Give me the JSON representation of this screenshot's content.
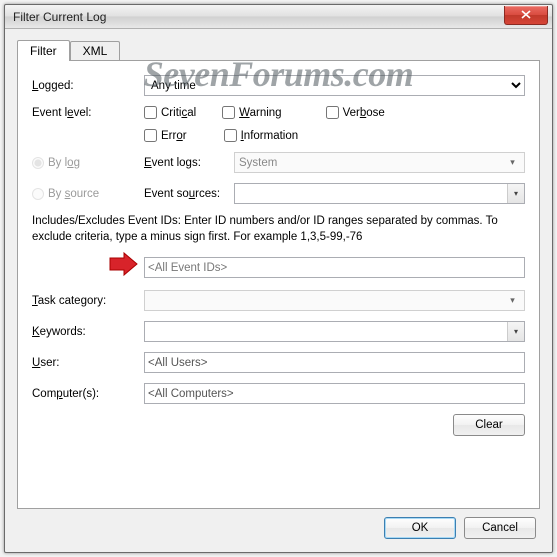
{
  "window": {
    "title": "Filter Current Log"
  },
  "watermark": "SevenForums.com",
  "tabs": {
    "filter": "Filter",
    "xml": "XML"
  },
  "form": {
    "logged_label": "Logged:",
    "logged_value": "Any time",
    "eventlevel_label": "Event level:",
    "critical": "Critical",
    "warning": "Warning",
    "verbose": "Verbose",
    "error": "Error",
    "information": "Information",
    "bylog": "By log",
    "bysource": "By source",
    "eventlogs_label": "Event logs:",
    "eventlogs_value": "System",
    "eventsources_label": "Event sources:",
    "description": "Includes/Excludes Event IDs: Enter ID numbers and/or ID ranges separated by commas. To exclude criteria, type a minus sign first. For example 1,3,5-99,-76",
    "eventids_placeholder": "<All Event IDs>",
    "taskcat_label": "Task category:",
    "keywords_label": "Keywords:",
    "user_label": "User:",
    "user_value": "<All Users>",
    "computers_label": "Computer(s):",
    "computers_value": "<All Computers>",
    "clear": "Clear"
  },
  "buttons": {
    "ok": "OK",
    "cancel": "Cancel"
  }
}
